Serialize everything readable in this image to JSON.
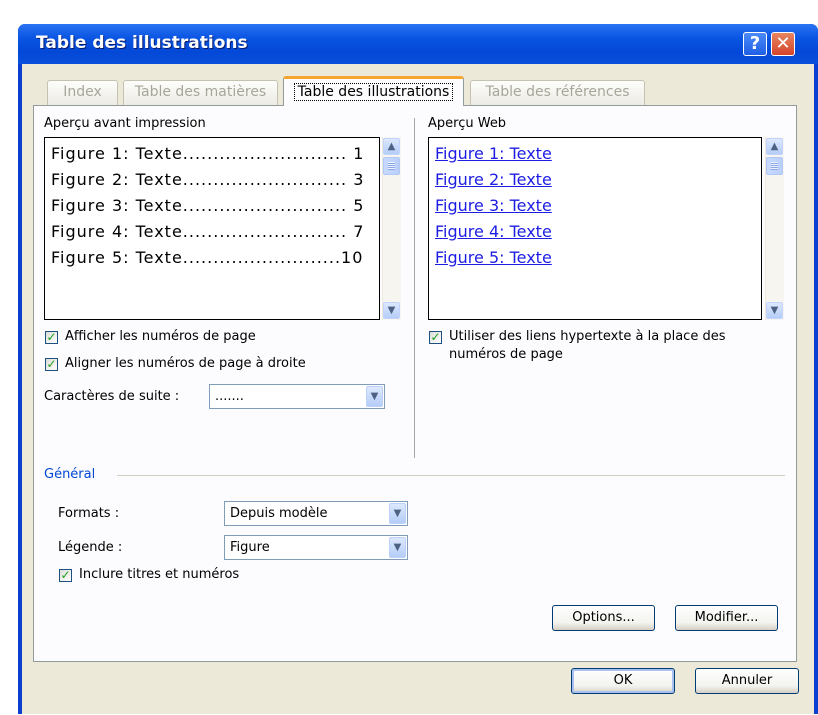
{
  "window": {
    "title": "Table des illustrations"
  },
  "titlebar": {
    "help_label": "?",
    "close_label": "✕"
  },
  "tabs": [
    {
      "label": "Index"
    },
    {
      "label": "Table des matières"
    },
    {
      "label": "Table des illustrations"
    },
    {
      "label": "Table des références"
    }
  ],
  "print_preview": {
    "label": "Aperçu avant impression",
    "items": [
      "Figure 1: Texte........................... 1",
      "Figure 2: Texte........................... 3",
      "Figure 3: Texte........................... 5",
      "Figure 4: Texte........................... 7",
      "Figure 5: Texte..........................10"
    ]
  },
  "web_preview": {
    "label": "Aperçu Web",
    "items": [
      "Figure 1: Texte",
      "Figure 2: Texte",
      "Figure 3: Texte",
      "Figure 4: Texte",
      "Figure 5: Texte"
    ]
  },
  "options": {
    "show_page_numbers": {
      "label": "Afficher les numéros de page",
      "checked": true
    },
    "align_right": {
      "label": "Aligner les numéros de page à droite",
      "checked": true
    },
    "tab_leader": {
      "label": "Caractères de suite :",
      "value": "......."
    },
    "use_hyperlinks": {
      "label_line1": "Utiliser des liens hypertexte à la place des",
      "label_line2": "numéros de page",
      "checked": true
    }
  },
  "general": {
    "title": "Général",
    "formats": {
      "label": "Formats :",
      "value": "Depuis modèle"
    },
    "caption": {
      "label": "Légende :",
      "value": "Figure"
    },
    "include": {
      "label": "Inclure titres et numéros",
      "checked": true
    }
  },
  "buttons": {
    "options": "Options...",
    "modify": "Modifier...",
    "ok": "OK",
    "cancel": "Annuler"
  },
  "glyphs": {
    "check": "✓",
    "arrow_up": "▲",
    "arrow_down": "▼"
  }
}
